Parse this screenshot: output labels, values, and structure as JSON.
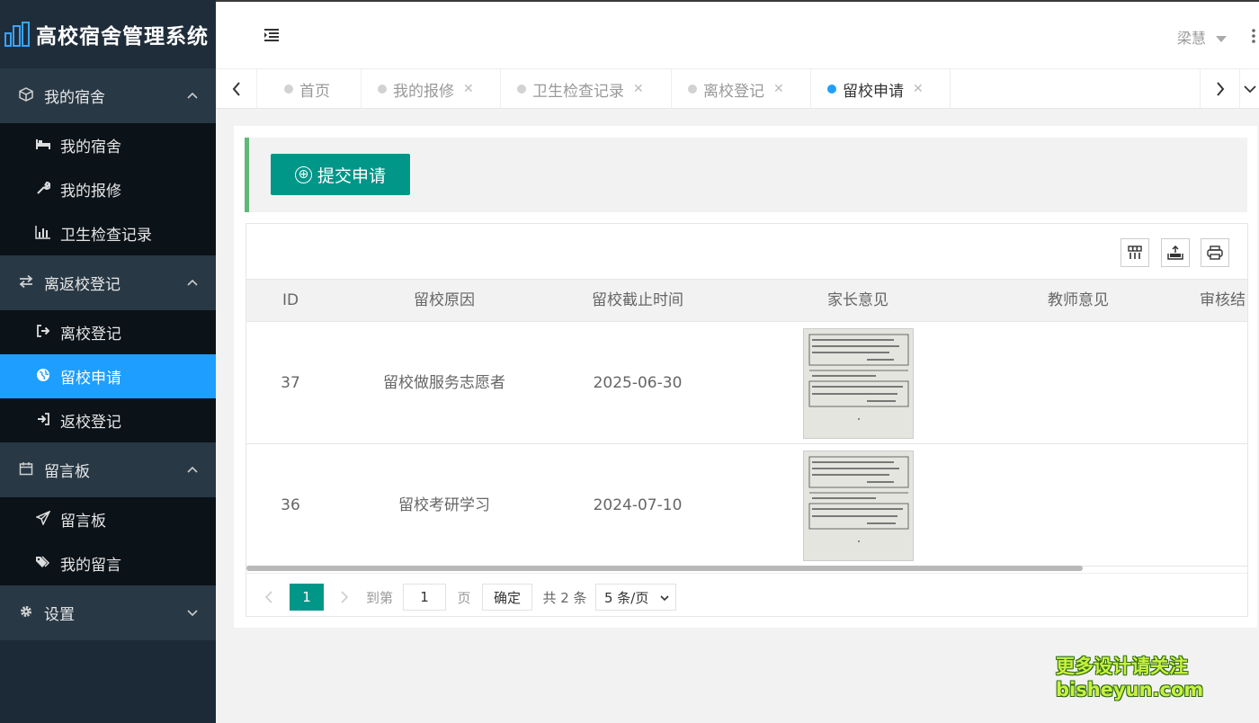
{
  "app": {
    "title": "高校宿舍管理系统"
  },
  "sidebar": {
    "groups": [
      {
        "label": "我的宿舍",
        "icon": "cube-icon",
        "items": [
          {
            "label": "我的宿舍",
            "icon": "bed-icon"
          },
          {
            "label": "我的报修",
            "icon": "wrench-icon"
          },
          {
            "label": "卫生检查记录",
            "icon": "bar-chart-icon"
          }
        ]
      },
      {
        "label": "离返校登记",
        "icon": "exchange-icon",
        "items": [
          {
            "label": "离校登记",
            "icon": "sign-out-icon"
          },
          {
            "label": "留校申请",
            "icon": "globe-icon",
            "active": true
          },
          {
            "label": "返校登记",
            "icon": "sign-in-icon"
          }
        ]
      },
      {
        "label": "留言板",
        "icon": "calendar-icon",
        "items": [
          {
            "label": "留言板",
            "icon": "paper-plane-icon"
          },
          {
            "label": "我的留言",
            "icon": "tags-icon"
          }
        ]
      },
      {
        "label": "设置",
        "icon": "gear-icon",
        "items": []
      }
    ]
  },
  "header": {
    "user_name": "梁慧"
  },
  "tabs": [
    {
      "label": "首页",
      "closable": false
    },
    {
      "label": "我的报修",
      "closable": true
    },
    {
      "label": "卫生检查记录",
      "closable": true
    },
    {
      "label": "离校登记",
      "closable": true
    },
    {
      "label": "留校申请",
      "closable": true,
      "active": true
    }
  ],
  "toolbar": {
    "submit_label": "提交申请",
    "submit_icon": "⊕"
  },
  "table": {
    "columns": [
      "ID",
      "留校原因",
      "留校截止时间",
      "家长意见",
      "教师意见",
      "审核结"
    ],
    "rows": [
      {
        "id": "37",
        "reason": "留校做服务志愿者",
        "deadline": "2025-06-30"
      },
      {
        "id": "36",
        "reason": "留校考研学习",
        "deadline": "2024-07-10"
      }
    ]
  },
  "pager": {
    "current": "1",
    "goto_label": "到第",
    "goto_value": "1",
    "page_unit": "页",
    "confirm": "确定",
    "total": "共 2 条",
    "page_size": "5 条/页"
  },
  "watermark": {
    "line1": "更多设计请关注",
    "line2": "bisheyun.com"
  },
  "colors": {
    "sidebar_bg": "#1b2a36",
    "active_blue": "#1e9fff",
    "primary_green": "#009688",
    "accent_bar": "#5fb878"
  }
}
